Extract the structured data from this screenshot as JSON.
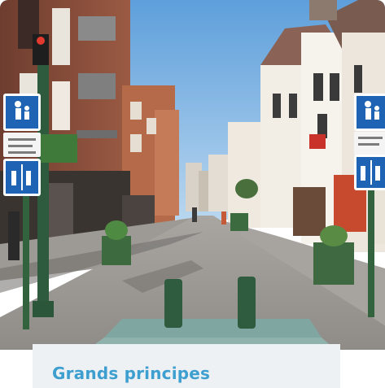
{
  "caption": {
    "title": "Grands principes"
  },
  "photo": {
    "subject": "pedestrian street with shops, bollards, planters and blue pedestrian signs"
  },
  "colors": {
    "caption_text": "#3d9fd0",
    "caption_background": "#eef1f3",
    "sign_blue": "#1f63b4",
    "sky": "#7db6e6"
  }
}
